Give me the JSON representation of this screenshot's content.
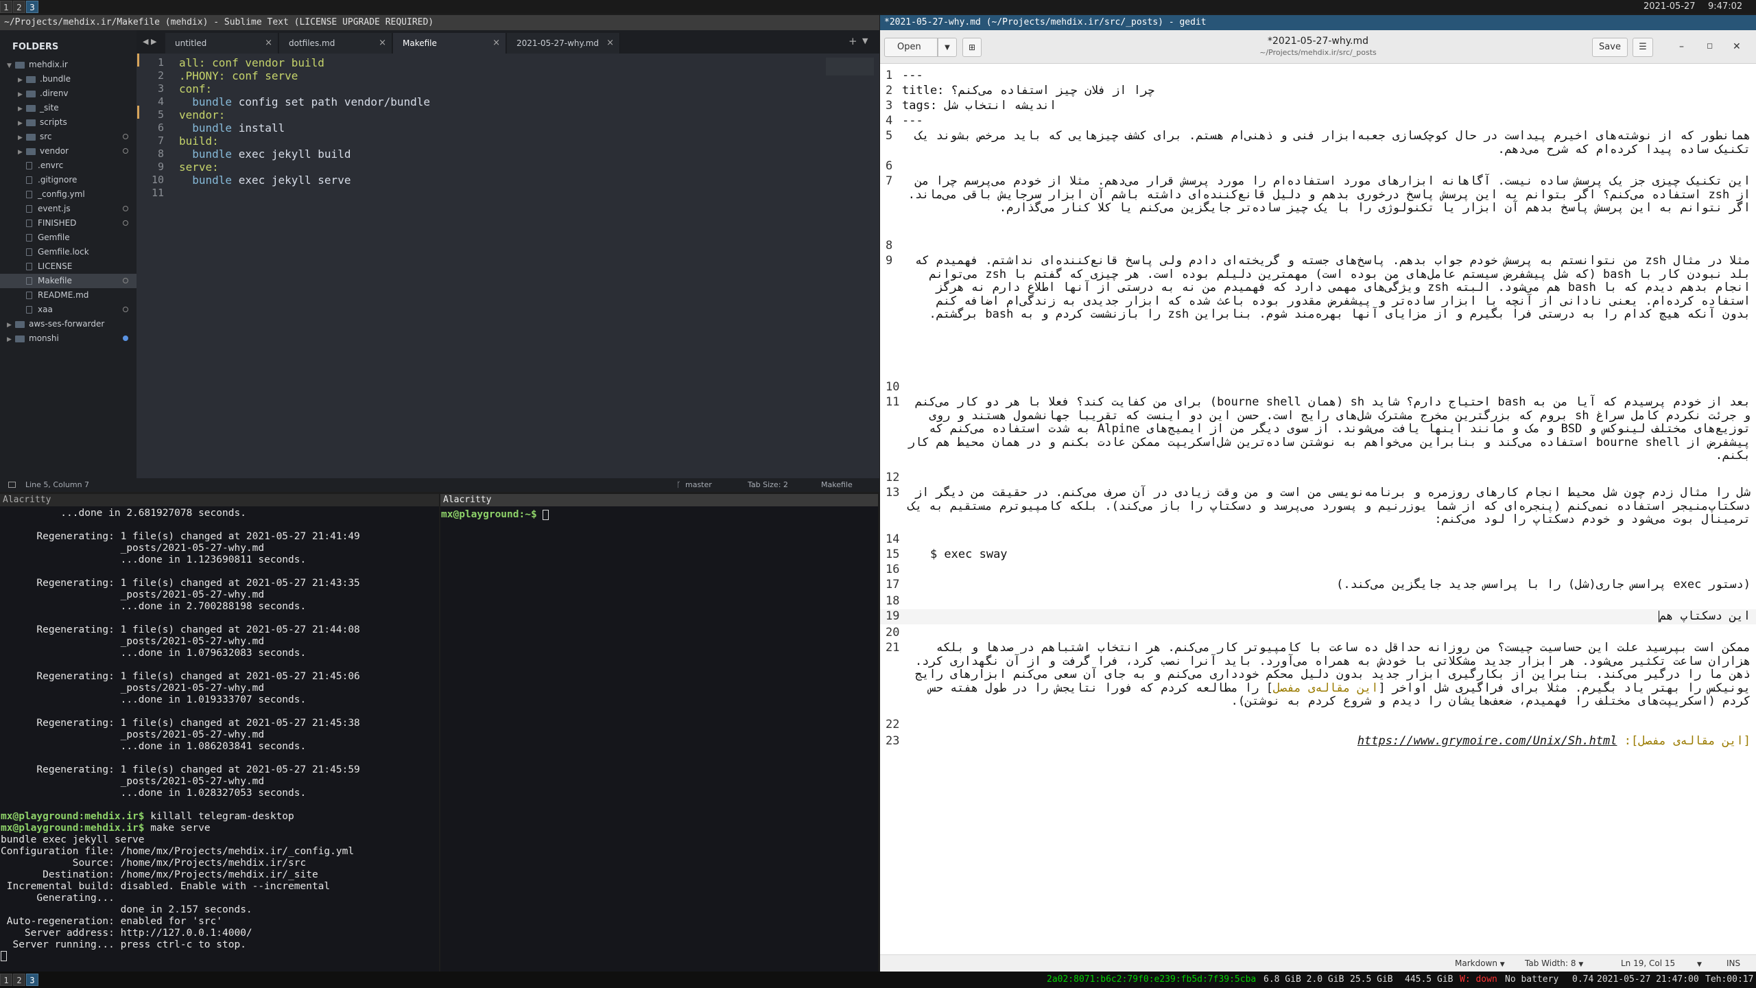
{
  "topbar": {
    "workspaces": [
      "1",
      "2",
      "3"
    ],
    "date": "2021-05-27",
    "time": "9:47:02"
  },
  "sublime": {
    "title": "~/Projects/mehdix.ir/Makefile (mehdix) - Sublime Text (LICENSE UPGRADE REQUIRED)",
    "folders_label": "FOLDERS",
    "tree": [
      {
        "name": "mehdix.ir",
        "type": "folder",
        "open": true,
        "depth": 0
      },
      {
        "name": ".bundle",
        "type": "folder",
        "depth": 1
      },
      {
        "name": ".direnv",
        "type": "folder",
        "depth": 1
      },
      {
        "name": "_site",
        "type": "folder",
        "depth": 1
      },
      {
        "name": "scripts",
        "type": "folder",
        "depth": 1
      },
      {
        "name": "src",
        "type": "folder",
        "depth": 1,
        "dot": true
      },
      {
        "name": "vendor",
        "type": "folder",
        "depth": 1,
        "dot": true
      },
      {
        "name": ".envrc",
        "type": "file",
        "depth": 1
      },
      {
        "name": ".gitignore",
        "type": "file",
        "depth": 1
      },
      {
        "name": "_config.yml",
        "type": "file",
        "depth": 1
      },
      {
        "name": "event.js",
        "type": "file",
        "depth": 1,
        "dot": true
      },
      {
        "name": "FINISHED",
        "type": "file",
        "depth": 1,
        "dot": true
      },
      {
        "name": "Gemfile",
        "type": "file",
        "depth": 1
      },
      {
        "name": "Gemfile.lock",
        "type": "file",
        "depth": 1
      },
      {
        "name": "LICENSE",
        "type": "file",
        "depth": 1
      },
      {
        "name": "Makefile",
        "type": "file",
        "depth": 1,
        "selected": true,
        "dot": true
      },
      {
        "name": "README.md",
        "type": "file",
        "depth": 1
      },
      {
        "name": "xaa",
        "type": "file",
        "depth": 1,
        "dot": true
      },
      {
        "name": "aws-ses-forwarder",
        "type": "folder",
        "depth": 0
      },
      {
        "name": "monshi",
        "type": "folder",
        "depth": 0,
        "dotblue": true
      }
    ],
    "tabs": [
      "untitled",
      "dotfiles.md",
      "Makefile",
      "2021-05-27-why.md"
    ],
    "active_tab": 2,
    "code": [
      [
        [
          "all: conf vendor build",
          "k1"
        ]
      ],
      [
        [
          ".PHONY: conf serve",
          "k1"
        ]
      ],
      [
        [
          "conf:",
          "k1"
        ]
      ],
      [
        [
          "  bundle",
          "k2"
        ],
        [
          " config set path vendor/bundle",
          ""
        ]
      ],
      [
        [
          "vendor:",
          "k1"
        ]
      ],
      [
        [
          "  bundle",
          "k2"
        ],
        [
          " install",
          ""
        ]
      ],
      [
        [
          "build:",
          "k1"
        ]
      ],
      [
        [
          "  bundle",
          "k2"
        ],
        [
          " exec jekyll build",
          ""
        ]
      ],
      [
        [
          "serve:",
          "k1"
        ]
      ],
      [
        [
          "  bundle",
          "k2"
        ],
        [
          " exec jekyll serve",
          ""
        ]
      ],
      [
        [
          "",
          ""
        ]
      ]
    ],
    "status_left": "Line 5, Column 7",
    "status_branch": "master",
    "status_tab": "Tab Size: 2",
    "status_syntax": "Makefile"
  },
  "term_left": {
    "title": "Alacritty",
    "lines": [
      "          ...done in 2.681927078 seconds.",
      "",
      "      Regenerating: 1 file(s) changed at 2021-05-27 21:41:49",
      "                    _posts/2021-05-27-why.md",
      "                    ...done in 1.123690811 seconds.",
      "",
      "      Regenerating: 1 file(s) changed at 2021-05-27 21:43:35",
      "                    _posts/2021-05-27-why.md",
      "                    ...done in 2.700288198 seconds.",
      "",
      "      Regenerating: 1 file(s) changed at 2021-05-27 21:44:08",
      "                    _posts/2021-05-27-why.md",
      "                    ...done in 1.079632083 seconds.",
      "",
      "      Regenerating: 1 file(s) changed at 2021-05-27 21:45:06",
      "                    _posts/2021-05-27-why.md",
      "                    ...done in 1.019333707 seconds.",
      "",
      "      Regenerating: 1 file(s) changed at 2021-05-27 21:45:38",
      "                    _posts/2021-05-27-why.md",
      "                    ...done in 1.086203841 seconds.",
      "",
      "      Regenerating: 1 file(s) changed at 2021-05-27 21:45:59",
      "                    _posts/2021-05-27-why.md",
      "                    ...done in 1.028327053 seconds.",
      ""
    ],
    "prompt": "mx@playground:mehdix.ir$",
    "cmd1": " killall telegram-desktop",
    "cmd2": " make serve",
    "out": [
      "bundle exec jekyll serve",
      "Configuration file: /home/mx/Projects/mehdix.ir/_config.yml",
      "            Source: /home/mx/Projects/mehdix.ir/src",
      "       Destination: /home/mx/Projects/mehdix.ir/_site",
      " Incremental build: disabled. Enable with --incremental",
      "      Generating...",
      "                    done in 2.157 seconds.",
      " Auto-regeneration: enabled for 'src'",
      "    Server address: http://127.0.0.1:4000/",
      "  Server running... press ctrl-c to stop."
    ]
  },
  "term_right": {
    "title": "Alacritty",
    "prompt": "mx@playground:~$"
  },
  "gedit": {
    "window_title": "*2021-05-27-why.md (~/Projects/mehdix.ir/src/_posts) - gedit",
    "open_label": "Open",
    "save_label": "Save",
    "doc_title": "*2021-05-27-why.md",
    "doc_path": "~/Projects/mehdix.ir/src/_posts",
    "line_numbers": [
      "1",
      "2",
      "3",
      "4",
      "5",
      "6",
      "7",
      "8",
      "9",
      "10",
      "11",
      "12",
      "13",
      "14",
      "15",
      "16",
      "17",
      "18",
      "19",
      "20",
      "21",
      "22",
      "23"
    ],
    "l1": "---",
    "l2": "title: چرا از فلان چیز استفاده می‌کنم؟",
    "l3": "tags: اندیشه انتخاب شل",
    "l4": "---",
    "l5": "همانطور که از نوشته‌های اخیرم پیداست در حال کوچک‌سازی جعبه‌ابزار فنی و ذهنی‌ام هستم. برای کشف چیزهایی که باید مرخص بشوند یک تکنیک ساده پیدا کرده‌ام که شرح می‌دهم.",
    "l7": "این تکنیک چیزی جز یک پرسش ساده نیست. آگاهانه ابزارهای مورد استفاده‌ام را مورد پرسش قرار می‌دهم. مثلا از خودم می‌پرسم چرا من از zsh استفاده می‌کنم؟ اگر بتوانم به این پرسش پاسخ درخوری بدهم و دلیل قانع‌کننده‌ای داشته باشم آن ابزار سرجایش باقی می‌ماند. اگر نتوانم به این پرسش پاسخ بدهم آن ابزار یا تکنولوژی را با یک چیز ساده‌تر جایگزین می‌کنم یا کلا کنار می‌گذارم.",
    "l9": "مثلا در مثال zsh من نتوانستم به پرسش خودم جواب بدهم. پاسخ‌های جسته و گریخته‌ای دادم ولی پاسخ قانع‌کننده‌ای نداشتم. فهمیدم که بلد نبودن کار با bash (که شل پیشفرض سیستم عامل‌های من بوده است) مهمترین دلیلم بوده است. هر چیزی که گفتم با zsh می‌توانم انجام بدهم دیدم که با bash هم می‌شود. البته zsh ویژگی‌های مهمی دارد که فهمیدم من نه به درستی از آنها اطلاع دارم نه هرگز استفاده کرده‌ام. یعنی نادانی از آنچه با ابزار ساده‌تر و پیشفرض مقدور بوده باعث شده که ابزار جدیدی به زندگی‌ام اضافه کنم بدون آنکه هیچ کدام را به درستی فرا بگیرم و از مزایای آنها بهره‌مند شوم. بنابراین zsh را بازنشست کردم و به bash برگشتم.",
    "l11": "بعد از خودم پرسیدم که آیا من به bash احتیاج دارم؟ شاید sh (همان bourne shell) برای من کفایت کند؟ فعلا با هر دو کار می‌کنم و جرئت نکردم کامل سراغ sh بروم که بزرگترین مخرج مشترک شل‌های رایج است. حسن این دو اینست که تقریبا جهانشمول هستند و روی توزیع‌های مختلف لینوکس و BSD و مک و مانند اینها یافت می‌شوند. از سوی دیگر من از ایمیج‌های Alpine به شدت استفاده می‌کنم که پیشفرض از bourne shell استفاده می‌کند و بنابراین می‌خواهم به نوشتن ساده‌ترین شل‌اسکریپت ممکن عادت بکنم و در همان محیط هم کار بکنم.",
    "l13": "شل را مثال زدم چون شل محیط انجام کارهای روزمره و برنامه‌نویسی من است و من وقت زیادی در آن صرف می‌کنم. در حقیقت من دیگر از دسکتاپ‌منیجر استفاده نمی‌کنم (پنجره‌ای که از شما یوزرنیم و پسورد می‌پرسد و دسکتاپ را باز می‌کند). بلکه کامپیوترم مستقیم به یک ترمینال بوت می‌شود و خودم دسکتاپ را لود می‌کنم:",
    "l15": "    $ exec sway",
    "l17": "(دستور exec پراسس جاری(شل) را با پراسس جدید جایگزین می‌کند.)",
    "l19": "این دسکتاپ هم",
    "l21a": "ممکن است بپرسید علت این حساسیت چیست؟ من روزانه حداقل ده ساعت با کامپیوتر کار می‌کنم. هر انتخاب اشتباهم در صدها و بلکه هزاران ساعت تکثیر می‌شود. هر ابزار جدید مشکلاتی با خودش به همراه می‌آورد. باید آنرا نصب کرد، فرا گرفت و از آن نگهداری کرد. ذهن ما را درگیر می‌کند. بنابراین از بکارگیری ابزار جدید بدون دلیل محکم خودداری می‌کنم و به جای آن سعی می‌کنم ابزارهای رایج یونیکس را بهتر یاد بگیرم. مثلا برای فراگیری شل اواخر [",
    "l21link": "این مقاله‌ی مفصل",
    "l21b": "] را مطالعه کردم که فورا نتایجش را در طول هفته حس کردم (اسکریپت‌های مختلف را فهمیدم، ضعف‌هایشان را دیدم و شروع کردم به نوشتن).",
    "l23link": "[این مقاله‌ی مفصل]: ",
    "l23url": "https://www.grymoire.com/Unix/Sh.html",
    "status_lang": "Markdown",
    "status_tab": "Tab Width: 8",
    "status_pos": "Ln 19, Col 15",
    "status_mode": "INS"
  },
  "bottombar": {
    "workspaces": [
      "1",
      "2",
      "3"
    ],
    "ip": "2a02:8071:b6c2:79f0:e239:fb5d:7f39:5cba",
    "mem": "6.8 GiB 2.0 GiB",
    "disk": "25.5 GiB",
    "disk2": "445.5 GiB",
    "wifi": "W: down",
    "battery": "No battery",
    "load": "0.74",
    "datetime": "2021-05-27 21:47:00",
    "tehran": "Teh:00:17"
  },
  "colors": {
    "accent": "#285577",
    "green": "#8ed269",
    "wifi_down": "#ff3333"
  }
}
